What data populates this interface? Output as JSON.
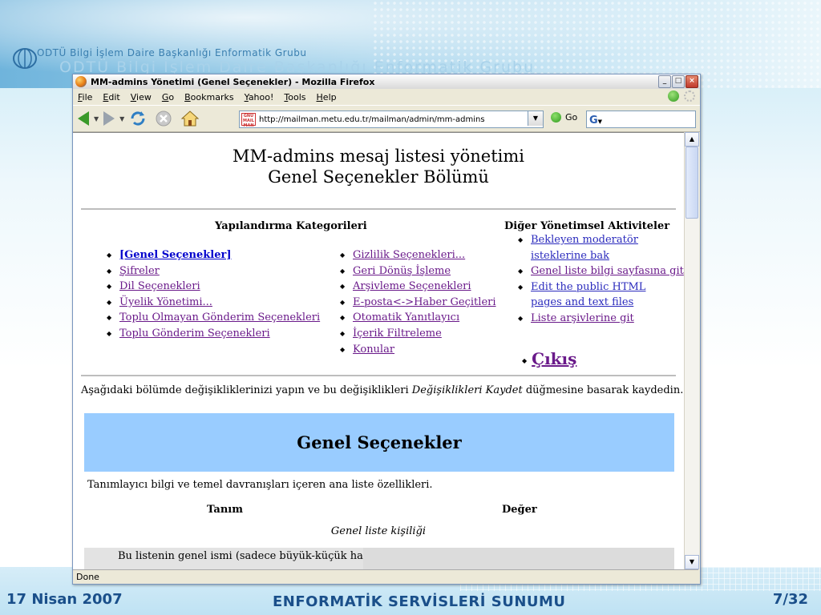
{
  "slide": {
    "header_small": "ODTÜ Bilgi İşlem Daire Başkanlığı Enformatik Grubu",
    "header_big": "ODTÜ Bilgi İşlem Daire Başkanlığı Enformatik Grubu",
    "footer_date": "17 Nisan 2007",
    "footer_title": "ENFORMATİK SERVİSLERİ SUNUMU",
    "footer_page": "7/32"
  },
  "browser": {
    "title": "MM-admins Yönetimi (Genel Seçenekler) - Mozilla Firefox",
    "menu": [
      "File",
      "Edit",
      "View",
      "Go",
      "Bookmarks",
      "Yahoo!",
      "Tools",
      "Help"
    ],
    "url": "http://mailman.metu.edu.tr/mailman/admin/mm-admins",
    "go_label": "Go",
    "status": "Done"
  },
  "page": {
    "heading_line1": "MM-admins mesaj listesi yönetimi",
    "heading_line2": "Genel Seçenekler Bölümü",
    "config_heading": "Yapılandırma Kategorileri",
    "other_heading": "Diğer Yönetimsel Aktiviteler",
    "col1": [
      "[Genel Seçenekler]",
      "Şifreler",
      "Dil Seçenekleri",
      "Üyelik Yönetimi...",
      "Toplu Olmayan Gönderim Seçenekleri",
      "Toplu Gönderim Seçenekleri"
    ],
    "col2": [
      "Gizlilik Seçenekleri...",
      "Geri Dönüş İşleme",
      "Arşivleme Seçenekleri",
      "E-posta<->Haber Geçitleri",
      "Otomatik Yanıtlayıcı",
      "İçerik Filtreleme",
      "Konular"
    ],
    "col3": [
      "Bekleyen moderatör",
      "isteklerine bak",
      "Genel liste bilgi sayfasına git",
      "Edit the public HTML",
      "pages and text files",
      "Liste arşivlerine git"
    ],
    "exit": "Çıkış",
    "intro_a": "Aşağıdaki bölümde değişikliklerinizi yapın ve bu değişiklikleri ",
    "intro_em": "Değişiklikleri Kaydet",
    "intro_b": " düğmesine basarak kaydedin.",
    "banner": "Genel Seçenekler",
    "desc": "Tanımlayıcı bilgi ve temel davranışları içeren ana liste özellikleri.",
    "col_tanim": "Tanım",
    "col_deger": "Değer",
    "section": "Genel liste kişiliği",
    "row1_label": "Bu listenin genel ismi (sadece büyük-küçük harf"
  }
}
